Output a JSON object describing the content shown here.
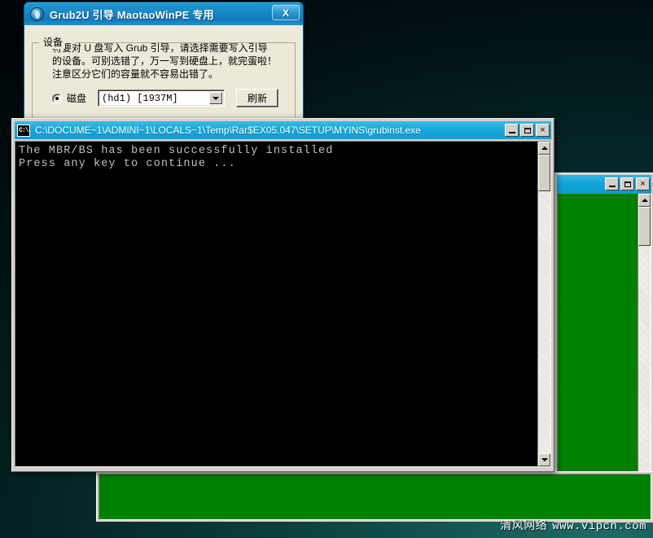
{
  "desktop": {
    "background_color_top": "#000508",
    "background_color_bottom": "#1d6b66",
    "watermark_text": "清风网络",
    "watermark_url": "www.vipcn.com"
  },
  "grub_dialog": {
    "icon": "globe-icon",
    "title": "Grub2U 引导 MaotaoWinPE 专用",
    "close_label": "X",
    "groupbox": {
      "legend": "设备",
      "description_lines": [
        "将要对 U 盘写入 Grub 引导，请选择需要写入引导",
        "的设备。可别选错了，万一写到硬盘上，就完蛋啦！",
        "注意区分它们的容量就不容易出错了。"
      ],
      "radio_label": "磁盘",
      "radio_checked": true,
      "combo_value": "(hd1) [1937M]",
      "refresh_label": "刷新"
    }
  },
  "console_window": {
    "icon": "console-icon",
    "title": "C:\\DOCUME~1\\ADMINI~1\\LOCALS~1\\Temp\\Rar$EX05.047\\SETUP\\MYINS\\grubinst.exe",
    "buttons": {
      "minimize": "minimize-icon",
      "maximize": "maximize-icon",
      "close": "×"
    },
    "output_lines": [
      "The MBR/BS has been successfully installed",
      "Press any key to continue ..."
    ],
    "scrollbar": {
      "up_arrow": "scroll-up-icon",
      "down_arrow": "scroll-down-icon"
    }
  },
  "background_window": {
    "content_color": "#008000",
    "buttons": {
      "minimize": "minimize-icon",
      "maximize": "maximize-icon",
      "close": "×"
    }
  }
}
